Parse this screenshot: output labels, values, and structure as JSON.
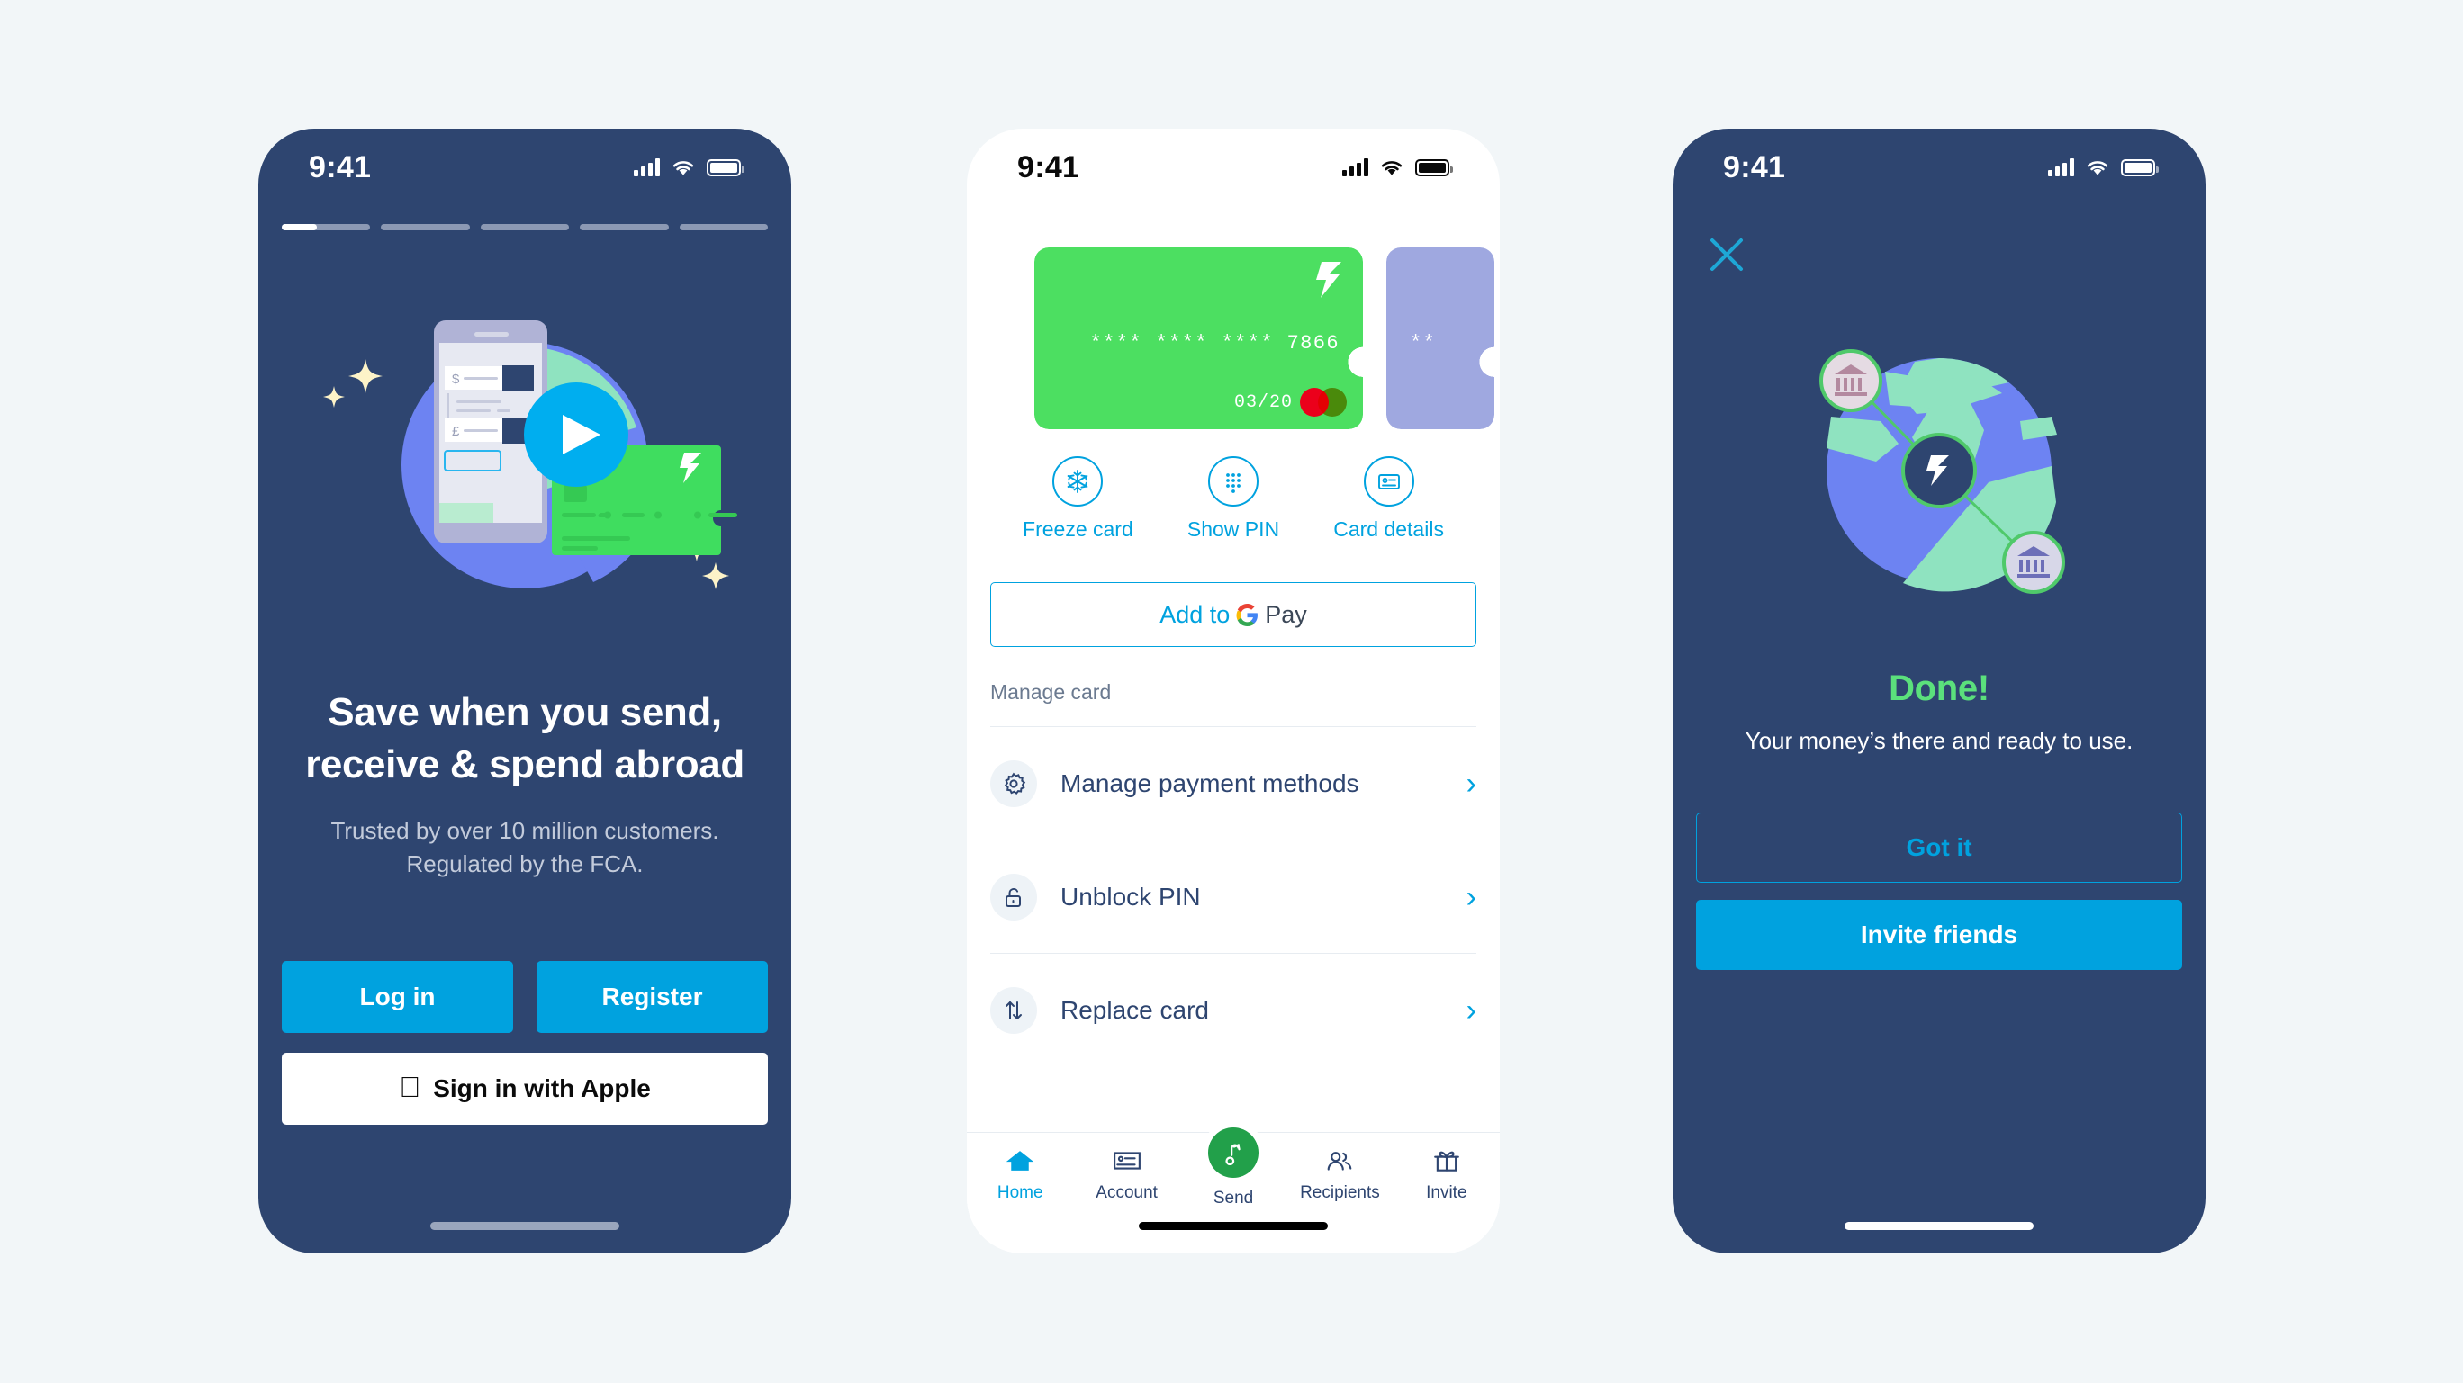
{
  "colors": {
    "canvas": "#f2f6f8",
    "navy": "#2e4570",
    "accent_blue": "#00a2df",
    "card_green": "#4cdf61",
    "card_purple": "#9fa8e0",
    "success_green": "#5be07c",
    "fab_green": "#22a04a",
    "globe_blue": "#6d83f2",
    "globe_mint": "#8fe3c0",
    "mc_red": "#eb001b",
    "mc_yellow": "#f79e1b"
  },
  "phone1": {
    "status": {
      "time": "9:41",
      "signal_icon": "signal-bars-icon",
      "wifi_icon": "wifi-icon",
      "battery_icon": "battery-icon"
    },
    "progress": {
      "total": 5,
      "active_index": 0,
      "active_fill_percent": 40
    },
    "illustration": {
      "name": "send-receive-spend-illustration",
      "phone_currency_from": "$",
      "phone_currency_to": "£",
      "play_button_icon": "play-icon",
      "card_logo_icon": "wise-logo-icon",
      "sparkle_icon": "sparkle-icon"
    },
    "title_line1": "Save when you send,",
    "title_line2": "receive & spend abroad",
    "sub_line1": "Trusted by over 10 million customers.",
    "sub_line2": "Regulated by the FCA.",
    "buttons": {
      "login": "Log in",
      "register": "Register",
      "apple": "Sign in with Apple",
      "apple_icon": "apple-logo-icon"
    }
  },
  "phone2": {
    "status": {
      "time": "9:41",
      "signal_icon": "signal-bars-icon",
      "wifi_icon": "wifi-icon",
      "battery_icon": "battery-icon"
    },
    "cards": [
      {
        "name": "green-debit-card",
        "color": "#4cdf61",
        "number": "**** **** **** 7866",
        "expiry": "03/20",
        "brand_icon": "mastercard-icon",
        "logo_icon": "wise-logo-icon"
      },
      {
        "name": "purple-debit-card",
        "color": "#9fa8e0",
        "number": "**"
      }
    ],
    "actions": [
      {
        "label": "Freeze card",
        "icon": "snowflake-icon"
      },
      {
        "label": "Show PIN",
        "icon": "keypad-dots-icon"
      },
      {
        "label": "Card details",
        "icon": "card-details-icon"
      }
    ],
    "gpay": {
      "add_text": "Add to",
      "pay_text": "Pay",
      "icon": "google-g-icon"
    },
    "section_label": "Manage card",
    "list": [
      {
        "label": "Manage payment methods",
        "icon": "gear-icon",
        "chevron": "›"
      },
      {
        "label": "Unblock PIN",
        "icon": "unlock-icon",
        "chevron": "›"
      },
      {
        "label": "Replace card",
        "icon": "swap-arrows-icon",
        "chevron": "›"
      }
    ],
    "tabs": [
      {
        "label": "Home",
        "icon": "home-icon",
        "active": true
      },
      {
        "label": "Account",
        "icon": "account-card-icon",
        "active": false
      },
      {
        "label": "Send",
        "icon": "send-arrow-icon",
        "active": false,
        "fab": true
      },
      {
        "label": "Recipients",
        "icon": "people-icon",
        "active": false
      },
      {
        "label": "Invite",
        "icon": "gift-icon",
        "active": false
      }
    ]
  },
  "phone3": {
    "status": {
      "time": "9:41",
      "signal_icon": "signal-bars-icon",
      "wifi_icon": "wifi-icon",
      "battery_icon": "battery-icon"
    },
    "close_icon": "close-icon",
    "illustration": {
      "name": "globe-transfer-illustration",
      "center_icon": "wise-logo-icon",
      "node_icon": "bank-building-icon",
      "node_count": 2
    },
    "title": "Done!",
    "subtitle": "Your money’s there and ready to use.",
    "buttons": {
      "got_it": "Got it",
      "invite": "Invite friends"
    }
  }
}
